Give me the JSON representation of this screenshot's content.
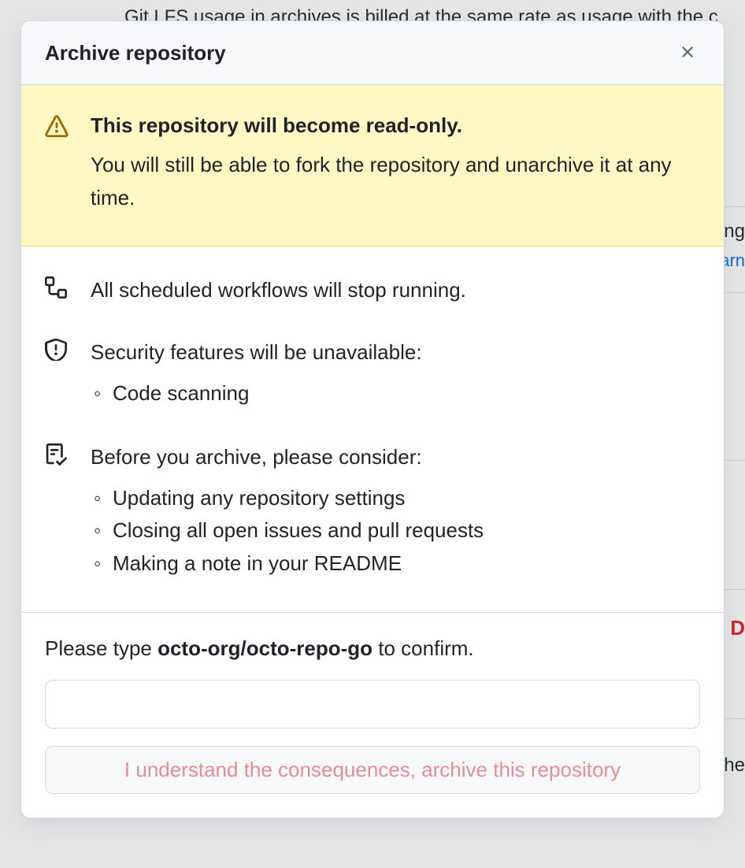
{
  "background": {
    "top_text": "Git LFS usage in archives is billed at the same rate as usage with the c",
    "right_frag1": "ng",
    "right_frag2": "arn",
    "right_frag3": "D",
    "right_frag4": "he"
  },
  "dialog": {
    "title": "Archive repository",
    "warning": {
      "heading": "This repository will become read-only.",
      "description": "You will still be able to fork the repository and unarchive it at any time."
    },
    "workflows": {
      "text": "All scheduled workflows will stop running."
    },
    "security": {
      "text": "Security features will be unavailable:",
      "items": [
        "Code scanning"
      ]
    },
    "considerations": {
      "text": "Before you archive, please consider:",
      "items": [
        "Updating any repository settings",
        "Closing all open issues and pull requests",
        "Making a note in your README"
      ]
    },
    "confirm": {
      "prefix": "Please type ",
      "repo": "octo-org/octo-repo-go",
      "suffix": " to confirm.",
      "input_value": "",
      "button": "I understand the consequences, archive this repository"
    }
  }
}
